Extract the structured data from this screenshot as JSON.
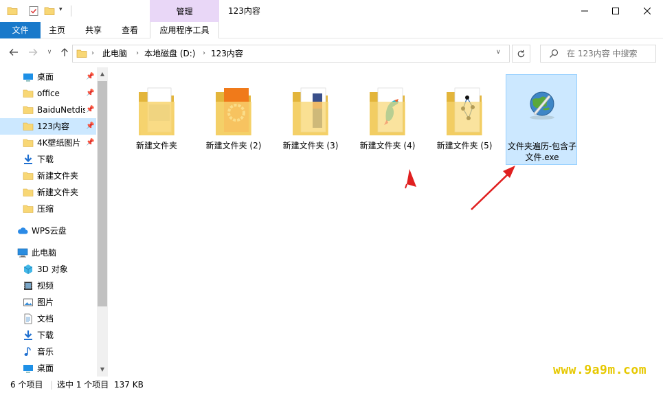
{
  "window": {
    "title": "123内容",
    "context_tab_header": "管理"
  },
  "ribbon": {
    "tabs": [
      "文件",
      "主页",
      "共享",
      "查看"
    ],
    "context_tab": "应用程序工具",
    "help_label": "?"
  },
  "address": {
    "crumbs": [
      "此电脑",
      "本地磁盘 (D:)",
      "123内容"
    ]
  },
  "search": {
    "placeholder": "在 123内容 中搜索"
  },
  "sidebar": {
    "items": [
      {
        "label": "桌面",
        "icon": "desktop-icon",
        "pinned": true
      },
      {
        "label": "office",
        "icon": "folder-icon",
        "pinned": true
      },
      {
        "label": "BaiduNetdis",
        "icon": "folder-icon",
        "pinned": true
      },
      {
        "label": "123内容",
        "icon": "folder-icon",
        "pinned": true,
        "selected": true
      },
      {
        "label": "4K壁纸图片",
        "icon": "folder-icon",
        "pinned": true
      },
      {
        "label": "下载",
        "icon": "download-icon",
        "pinned": false
      },
      {
        "label": "新建文件夹",
        "icon": "folder-icon",
        "pinned": false
      },
      {
        "label": "新建文件夹",
        "icon": "folder-icon",
        "pinned": false
      },
      {
        "label": "压缩",
        "icon": "folder-icon",
        "pinned": false
      },
      {
        "label": "WPS云盘",
        "icon": "cloud-icon",
        "pinned": false
      },
      {
        "label": "此电脑",
        "icon": "computer-icon",
        "pinned": false
      },
      {
        "label": "3D 对象",
        "icon": "3d-objects-icon",
        "pinned": false
      },
      {
        "label": "视频",
        "icon": "video-icon",
        "pinned": false
      },
      {
        "label": "图片",
        "icon": "picture-icon",
        "pinned": false
      },
      {
        "label": "文档",
        "icon": "document-icon",
        "pinned": false
      },
      {
        "label": "下载",
        "icon": "download-icon",
        "pinned": false
      },
      {
        "label": "音乐",
        "icon": "music-icon",
        "pinned": false
      },
      {
        "label": "桌面",
        "icon": "desktop-icon",
        "pinned": false
      }
    ]
  },
  "files": [
    {
      "name": "新建文件夹",
      "type": "folder"
    },
    {
      "name": "新建文件夹 (2)",
      "type": "folder"
    },
    {
      "name": "新建文件夹 (3)",
      "type": "folder"
    },
    {
      "name": "新建文件夹 (4)",
      "type": "folder"
    },
    {
      "name": "新建文件夹 (5)",
      "type": "folder"
    },
    {
      "name": "文件夹遍历-包含子文件.exe",
      "type": "exe",
      "selected": true
    }
  ],
  "status": {
    "count": "6 个项目",
    "selection": "选中 1 个项目",
    "size": "137 KB"
  },
  "watermark": "www.9a9m.com",
  "colors": {
    "accent": "#1979ca",
    "context_tab": "#e9d7f7",
    "selection": "#cce8ff",
    "folder": "#f8d775",
    "arrow": "#e02020"
  }
}
